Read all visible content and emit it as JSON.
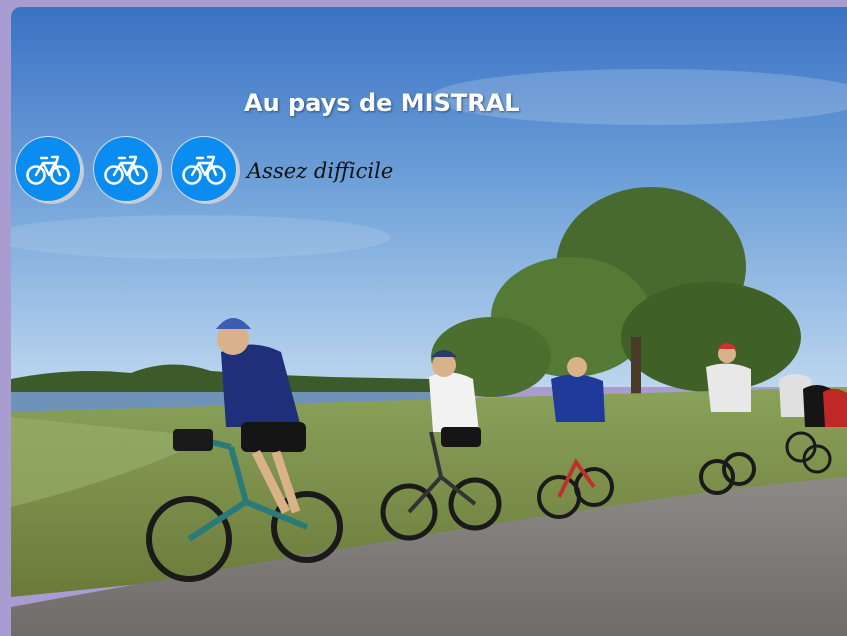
{
  "page": {
    "title": "Au pays de MISTRAL",
    "difficulty_label": "Assez difficile",
    "difficulty_icon": "bicycle-icon",
    "difficulty_level": 3
  },
  "colors": {
    "frame": "#a89cd0",
    "badge": "#0a8cf0",
    "sky_top": "#3f78c8",
    "sky_bottom": "#b8d4ee"
  }
}
